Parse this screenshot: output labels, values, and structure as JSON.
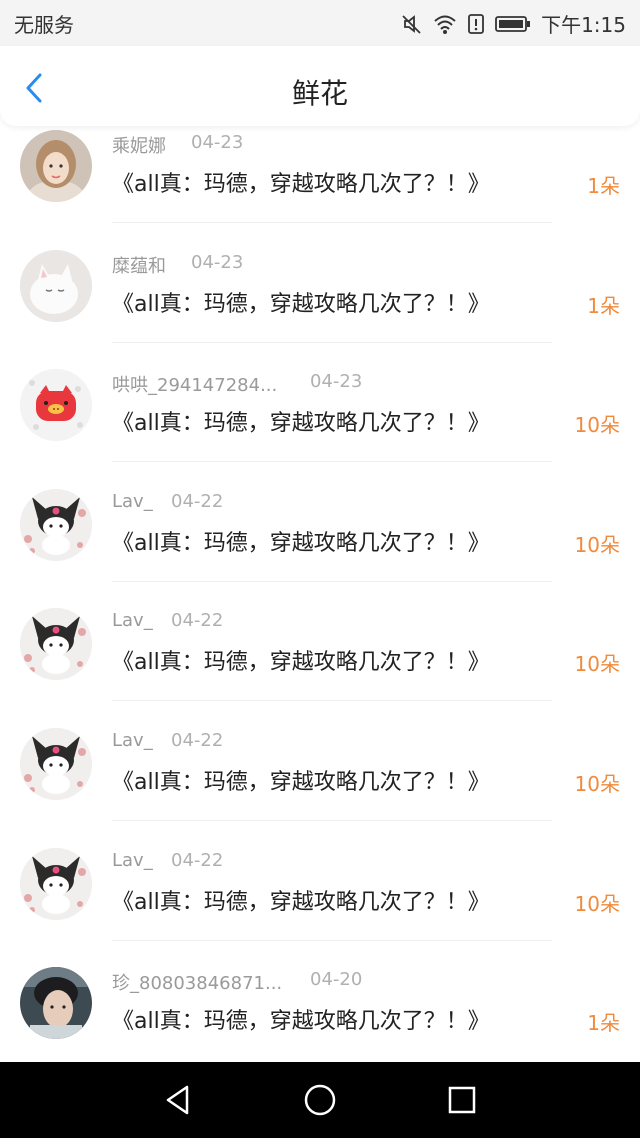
{
  "status_bar": {
    "carrier": "无服务",
    "time": "下午1:15",
    "icons": [
      "mute-icon",
      "wifi-icon",
      "alert-icon",
      "battery-icon"
    ]
  },
  "header": {
    "title": "鲜花",
    "back_icon": "chevron-left-icon",
    "accent_color": "#2a8cf0"
  },
  "items": [
    {
      "name": "乘妮娜",
      "date": "04-23",
      "text": "《all真：玛德，穿越攻略几次了？！》",
      "count": "1朵",
      "avatar": "photo-girl"
    },
    {
      "name": "糜蕴和",
      "date": "04-23",
      "text": "《all真：玛德，穿越攻略几次了？！》",
      "count": "1朵",
      "avatar": "white-cat"
    },
    {
      "name": "哄哄_294147284...",
      "date": "04-23",
      "text": "《all真：玛德，穿越攻略几次了？！》",
      "count": "10朵",
      "avatar": "red-pig"
    },
    {
      "name": "Lav_",
      "date": "04-22",
      "text": "《all真：玛德，穿越攻略几次了？！》",
      "count": "10朵",
      "avatar": "kuromi"
    },
    {
      "name": "Lav_",
      "date": "04-22",
      "text": "《all真：玛德，穿越攻略几次了？！》",
      "count": "10朵",
      "avatar": "kuromi"
    },
    {
      "name": "Lav_",
      "date": "04-22",
      "text": "《all真：玛德，穿越攻略几次了？！》",
      "count": "10朵",
      "avatar": "kuromi"
    },
    {
      "name": "Lav_",
      "date": "04-22",
      "text": "《all真：玛德，穿越攻略几次了？！》",
      "count": "10朵",
      "avatar": "kuromi"
    },
    {
      "name": "珍_80803846871...",
      "date": "04-20",
      "text": "《all真：玛德，穿越攻略几次了？！》",
      "count": "1朵",
      "avatar": "photo-boy"
    }
  ],
  "colors": {
    "count": "#f08a3c",
    "name": "#9a9a9a",
    "nav_bar": "#000000"
  },
  "nav_bar": {
    "icons": [
      "back-triangle-icon",
      "home-circle-icon",
      "recents-square-icon"
    ]
  }
}
